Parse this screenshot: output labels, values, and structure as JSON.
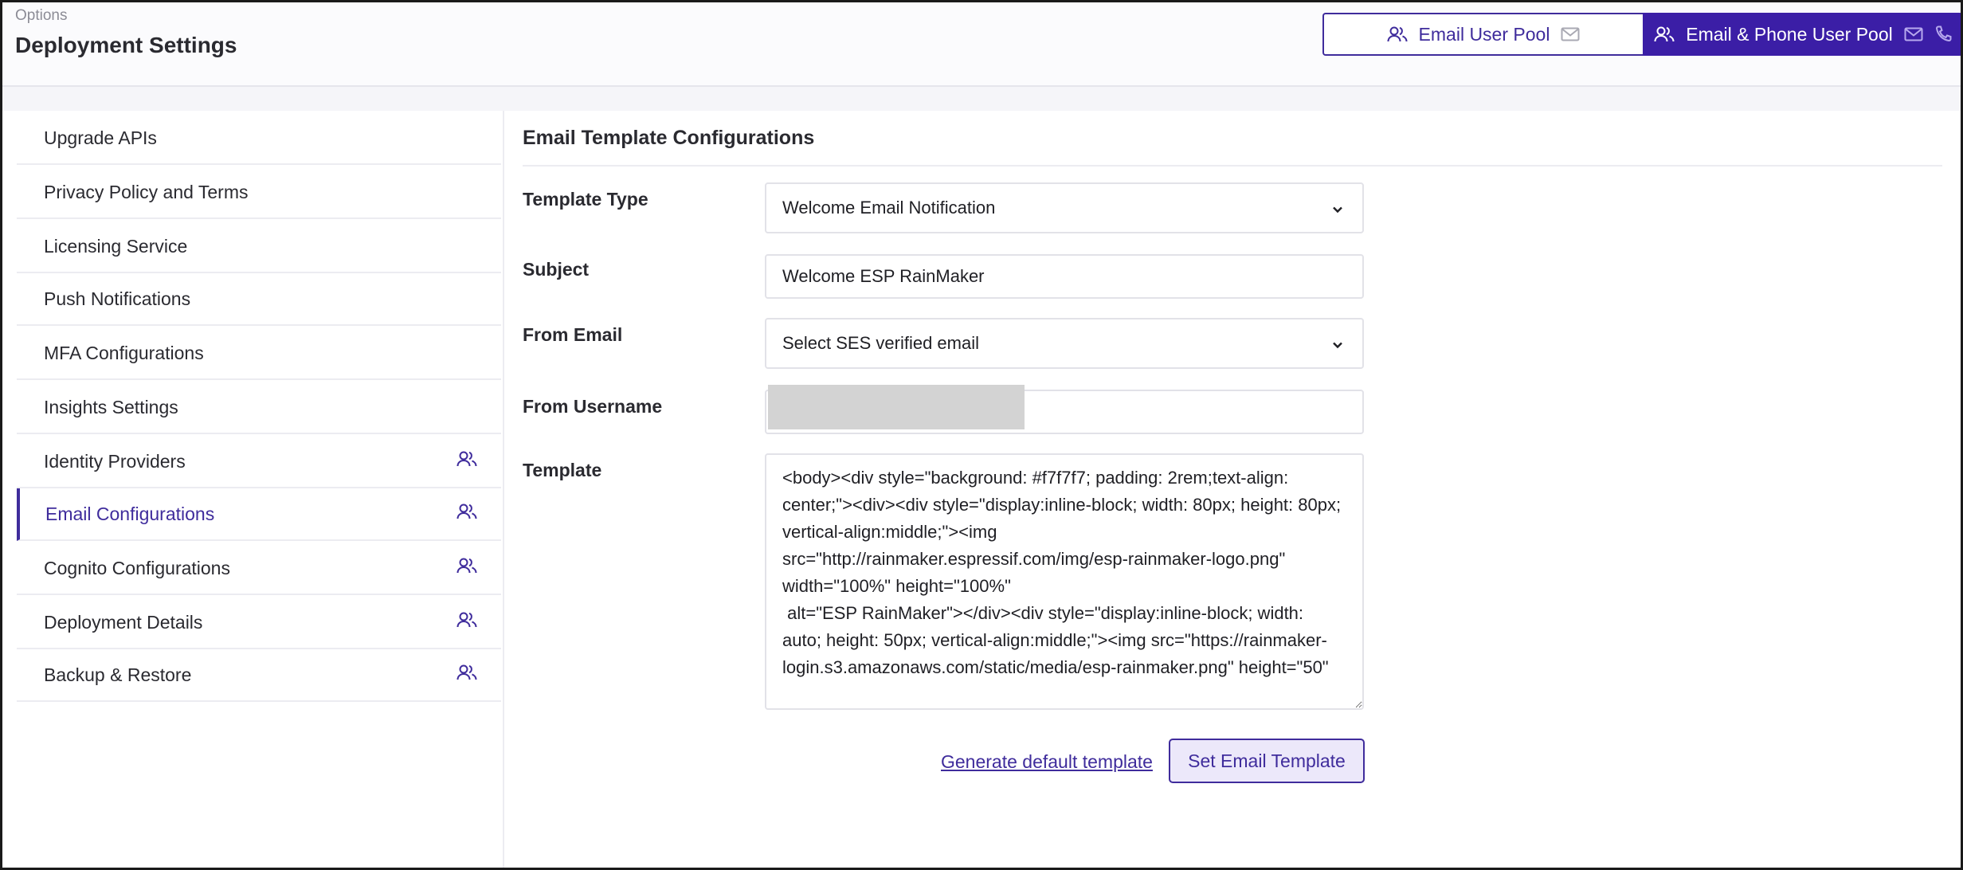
{
  "header": {
    "breadcrumb": "Options",
    "title": "Deployment Settings",
    "pool_toggle": {
      "email_pool_label": "Email User Pool",
      "email_phone_pool_label": "Email & Phone User Pool",
      "selected": "Email & Phone User Pool"
    }
  },
  "sidebar": {
    "items": [
      {
        "label": "Upgrade APIs",
        "icon": ""
      },
      {
        "label": "Privacy Policy and Terms",
        "icon": ""
      },
      {
        "label": "Licensing Service",
        "icon": ""
      },
      {
        "label": "Push Notifications",
        "icon": ""
      },
      {
        "label": "MFA Configurations",
        "icon": ""
      },
      {
        "label": "Insights Settings",
        "icon": ""
      },
      {
        "label": "Identity Providers",
        "icon": "users-icon"
      },
      {
        "label": "Email Configurations",
        "icon": "users-icon"
      },
      {
        "label": "Cognito Configurations",
        "icon": "users-icon"
      },
      {
        "label": "Deployment Details",
        "icon": "users-icon"
      },
      {
        "label": "Backup & Restore",
        "icon": "users-icon"
      }
    ],
    "active": "Email Configurations"
  },
  "main": {
    "section_title": "Email Template Configurations",
    "template_type": {
      "label": "Template Type",
      "value": "Welcome Email Notification"
    },
    "subject": {
      "label": "Subject",
      "value": "Welcome ESP RainMaker"
    },
    "from_email": {
      "label": "From Email",
      "value": "Select SES verified email"
    },
    "from_username": {
      "label": "From Username",
      "value": ""
    },
    "template": {
      "label": "Template",
      "value": "<body><div style=\"background: #f7f7f7; padding: 2rem;text-align: center;\"><div><div style=\"display:inline-block; width: 80px; height: 80px; vertical-align:middle;\"><img src=\"http://rainmaker.espressif.com/img/esp-rainmaker-logo.png\" width=\"100%\" height=\"100%\"\n alt=\"ESP RainMaker\"></div><div style=\"display:inline-block; width: auto; height: 50px; vertical-align:middle;\"><img src=\"https://rainmaker-login.s3.amazonaws.com/static/media/esp-rainmaker.png\" height=\"50\""
    },
    "actions": {
      "generate_label": "Generate default template",
      "set_label": "Set Email Template"
    }
  },
  "colors": {
    "accent": "#3b1ea6",
    "accent_light": "#ece8fa"
  }
}
